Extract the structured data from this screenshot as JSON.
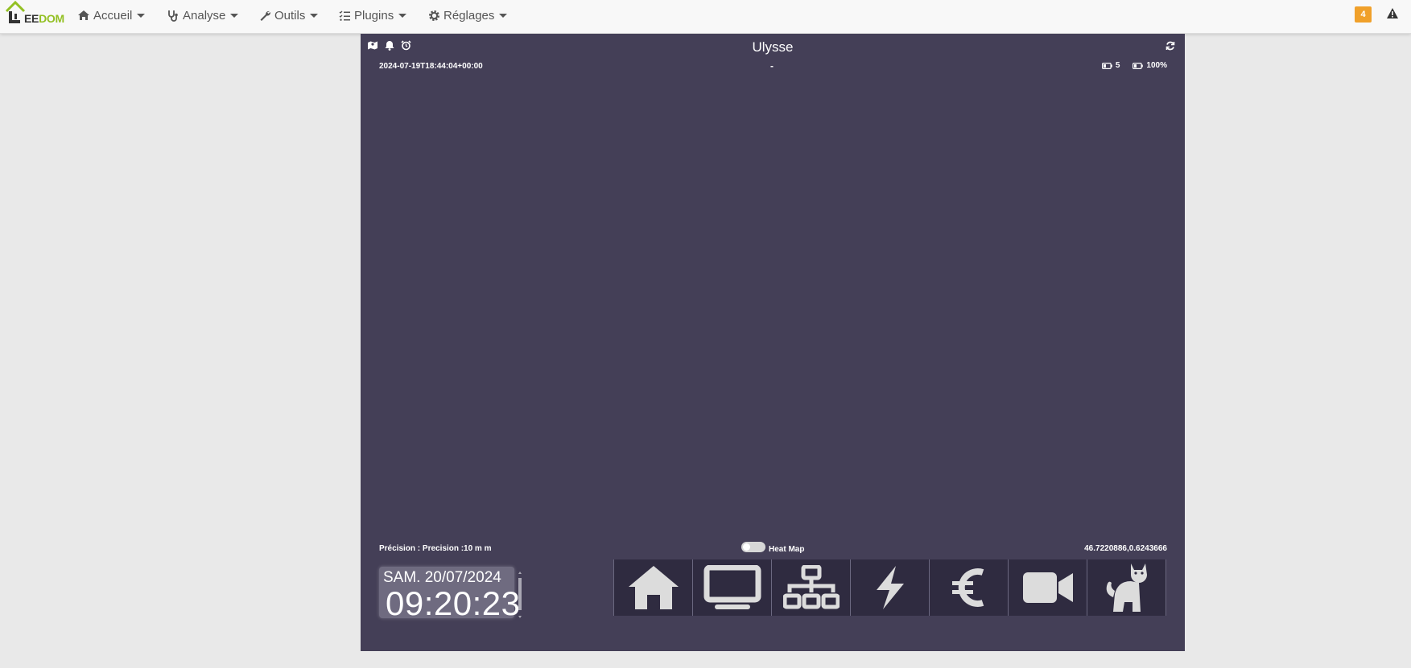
{
  "navbar": {
    "logo_text_a": "EE",
    "logo_text_b": "DOM",
    "menu": [
      {
        "label": "Accueil",
        "icon": "home-icon"
      },
      {
        "label": "Analyse",
        "icon": "stethoscope-icon"
      },
      {
        "label": "Outils",
        "icon": "wrench-icon"
      },
      {
        "label": "Plugins",
        "icon": "tasks-icon"
      },
      {
        "label": "Réglages",
        "icon": "gear-icon"
      }
    ],
    "notification_count": "4",
    "badge_color": "#f0a02a",
    "brand_green": "#93c023"
  },
  "widget": {
    "background": "#443f57",
    "title": "Ulysse",
    "timestamp": "2024-07-19T18:44:04+00:00",
    "dash": "-",
    "battery_1": "5",
    "battery_2": "100%",
    "precision": "Précision : Precision :10 m m",
    "heatmap_label": "Heat Map",
    "coordinates": "46.7220886,0.6243666",
    "header_icons": [
      "map-icon",
      "bell-icon",
      "alarm-clock-icon"
    ]
  },
  "clock": {
    "date": "SAM. 20/07/2024",
    "time": "09:20:23"
  },
  "tiles": [
    {
      "name": "home-icon"
    },
    {
      "name": "monitor-icon"
    },
    {
      "name": "network-icon"
    },
    {
      "name": "lightning-icon"
    },
    {
      "name": "euro-icon"
    },
    {
      "name": "video-camera-icon"
    },
    {
      "name": "cat-icon"
    }
  ]
}
